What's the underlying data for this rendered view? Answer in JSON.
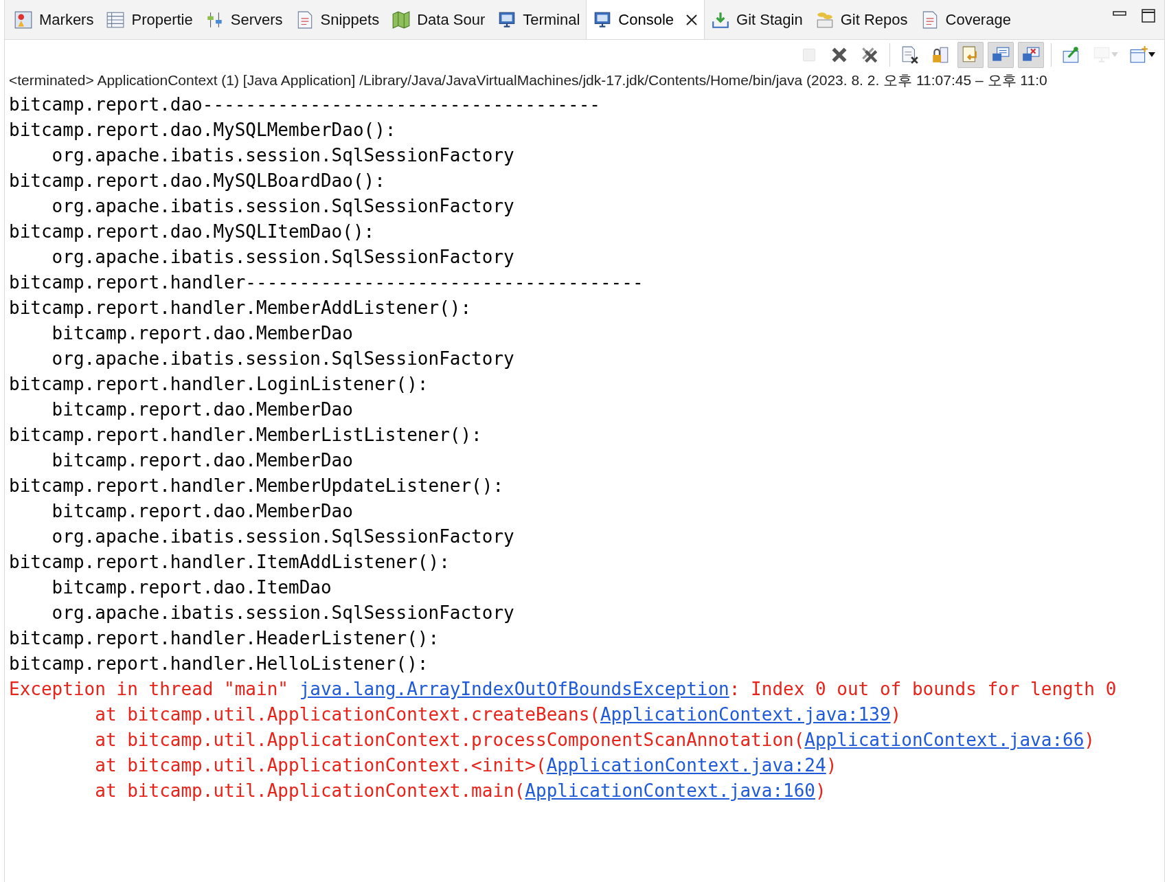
{
  "tabs": [
    {
      "label": "Markers",
      "kind": "markers",
      "selected": false,
      "closable": false
    },
    {
      "label": "Propertie",
      "kind": "table",
      "selected": false,
      "closable": false
    },
    {
      "label": "Servers",
      "kind": "sliders",
      "selected": false,
      "closable": false
    },
    {
      "label": "Snippets",
      "kind": "doc",
      "selected": false,
      "closable": false
    },
    {
      "label": "Data Sour",
      "kind": "map",
      "selected": false,
      "closable": false
    },
    {
      "label": "Terminal",
      "kind": "monitor",
      "selected": false,
      "closable": false
    },
    {
      "label": "Console",
      "kind": "monitor",
      "selected": true,
      "closable": true
    },
    {
      "label": "Git Stagin",
      "kind": "download",
      "selected": false,
      "closable": false
    },
    {
      "label": "Git Repos",
      "kind": "git",
      "selected": false,
      "closable": false
    },
    {
      "label": "Coverage",
      "kind": "doc",
      "selected": false,
      "closable": false
    }
  ],
  "toolbar": [
    {
      "kind": "stop",
      "disabled": true,
      "pressed": false
    },
    {
      "kind": "remove",
      "disabled": false,
      "pressed": false
    },
    {
      "kind": "remove-all",
      "disabled": false,
      "pressed": false
    },
    {
      "kind": "sep"
    },
    {
      "kind": "clear",
      "disabled": false,
      "pressed": false
    },
    {
      "kind": "lock",
      "disabled": false,
      "pressed": false
    },
    {
      "kind": "wrap",
      "disabled": false,
      "pressed": true
    },
    {
      "kind": "stdout",
      "disabled": false,
      "pressed": true
    },
    {
      "kind": "stderr",
      "disabled": false,
      "pressed": true
    },
    {
      "kind": "sep"
    },
    {
      "kind": "pin",
      "disabled": false,
      "pressed": false
    },
    {
      "kind": "display",
      "disabled": true,
      "pressed": false,
      "dropdown": true
    },
    {
      "kind": "new",
      "disabled": false,
      "pressed": false,
      "dropdown": true
    }
  ],
  "status": "<terminated> ApplicationContext (1) [Java Application] /Library/Java/JavaVirtualMachines/jdk-17.jdk/Contents/Home/bin/java  (2023. 8. 2. 오후 11:07:45 – 오후 11:0",
  "console": [
    {
      "kind": "out",
      "parts": [
        {
          "text": "bitcamp.report.dao-------------------------------------"
        }
      ]
    },
    {
      "kind": "out",
      "parts": [
        {
          "text": "bitcamp.report.dao.MySQLMemberDao():"
        }
      ]
    },
    {
      "kind": "out",
      "parts": [
        {
          "text": "    org.apache.ibatis.session.SqlSessionFactory"
        }
      ]
    },
    {
      "kind": "out",
      "parts": [
        {
          "text": "bitcamp.report.dao.MySQLBoardDao():"
        }
      ]
    },
    {
      "kind": "out",
      "parts": [
        {
          "text": "    org.apache.ibatis.session.SqlSessionFactory"
        }
      ]
    },
    {
      "kind": "out",
      "parts": [
        {
          "text": "bitcamp.report.dao.MySQLItemDao():"
        }
      ]
    },
    {
      "kind": "out",
      "parts": [
        {
          "text": "    org.apache.ibatis.session.SqlSessionFactory"
        }
      ]
    },
    {
      "kind": "out",
      "parts": [
        {
          "text": "bitcamp.report.handler-------------------------------------"
        }
      ]
    },
    {
      "kind": "out",
      "parts": [
        {
          "text": "bitcamp.report.handler.MemberAddListener():"
        }
      ]
    },
    {
      "kind": "out",
      "parts": [
        {
          "text": "    bitcamp.report.dao.MemberDao"
        }
      ]
    },
    {
      "kind": "out",
      "parts": [
        {
          "text": "    org.apache.ibatis.session.SqlSessionFactory"
        }
      ]
    },
    {
      "kind": "out",
      "parts": [
        {
          "text": "bitcamp.report.handler.LoginListener():"
        }
      ]
    },
    {
      "kind": "out",
      "parts": [
        {
          "text": "    bitcamp.report.dao.MemberDao"
        }
      ]
    },
    {
      "kind": "out",
      "parts": [
        {
          "text": "bitcamp.report.handler.MemberListListener():"
        }
      ]
    },
    {
      "kind": "out",
      "parts": [
        {
          "text": "    bitcamp.report.dao.MemberDao"
        }
      ]
    },
    {
      "kind": "out",
      "parts": [
        {
          "text": "bitcamp.report.handler.MemberUpdateListener():"
        }
      ]
    },
    {
      "kind": "out",
      "parts": [
        {
          "text": "    bitcamp.report.dao.MemberDao"
        }
      ]
    },
    {
      "kind": "out",
      "parts": [
        {
          "text": "    org.apache.ibatis.session.SqlSessionFactory"
        }
      ]
    },
    {
      "kind": "out",
      "parts": [
        {
          "text": "bitcamp.report.handler.ItemAddListener():"
        }
      ]
    },
    {
      "kind": "out",
      "parts": [
        {
          "text": "    bitcamp.report.dao.ItemDao"
        }
      ]
    },
    {
      "kind": "out",
      "parts": [
        {
          "text": "    org.apache.ibatis.session.SqlSessionFactory"
        }
      ]
    },
    {
      "kind": "out",
      "parts": [
        {
          "text": "bitcamp.report.handler.HeaderListener():"
        }
      ]
    },
    {
      "kind": "out",
      "parts": [
        {
          "text": "bitcamp.report.handler.HelloListener():"
        }
      ]
    },
    {
      "kind": "err",
      "parts": [
        {
          "text": "Exception in thread \"main\" "
        },
        {
          "text": "java.lang.ArrayIndexOutOfBoundsException",
          "link": true
        },
        {
          "text": ": Index 0 out of bounds for length 0"
        }
      ]
    },
    {
      "kind": "err",
      "parts": [
        {
          "text": "        at bitcamp.util.ApplicationContext.createBeans("
        },
        {
          "text": "ApplicationContext.java:139",
          "link": true
        },
        {
          "text": ")"
        }
      ]
    },
    {
      "kind": "err",
      "parts": [
        {
          "text": "        at bitcamp.util.ApplicationContext.processComponentScanAnnotation("
        },
        {
          "text": "ApplicationContext.java:66",
          "link": true
        },
        {
          "text": ")"
        }
      ]
    },
    {
      "kind": "err",
      "parts": [
        {
          "text": "        at bitcamp.util.ApplicationContext.<init>("
        },
        {
          "text": "ApplicationContext.java:24",
          "link": true
        },
        {
          "text": ")"
        }
      ]
    },
    {
      "kind": "err",
      "parts": [
        {
          "text": "        at bitcamp.util.ApplicationContext.main("
        },
        {
          "text": "ApplicationContext.java:160",
          "link": true
        },
        {
          "text": ")"
        }
      ]
    }
  ]
}
